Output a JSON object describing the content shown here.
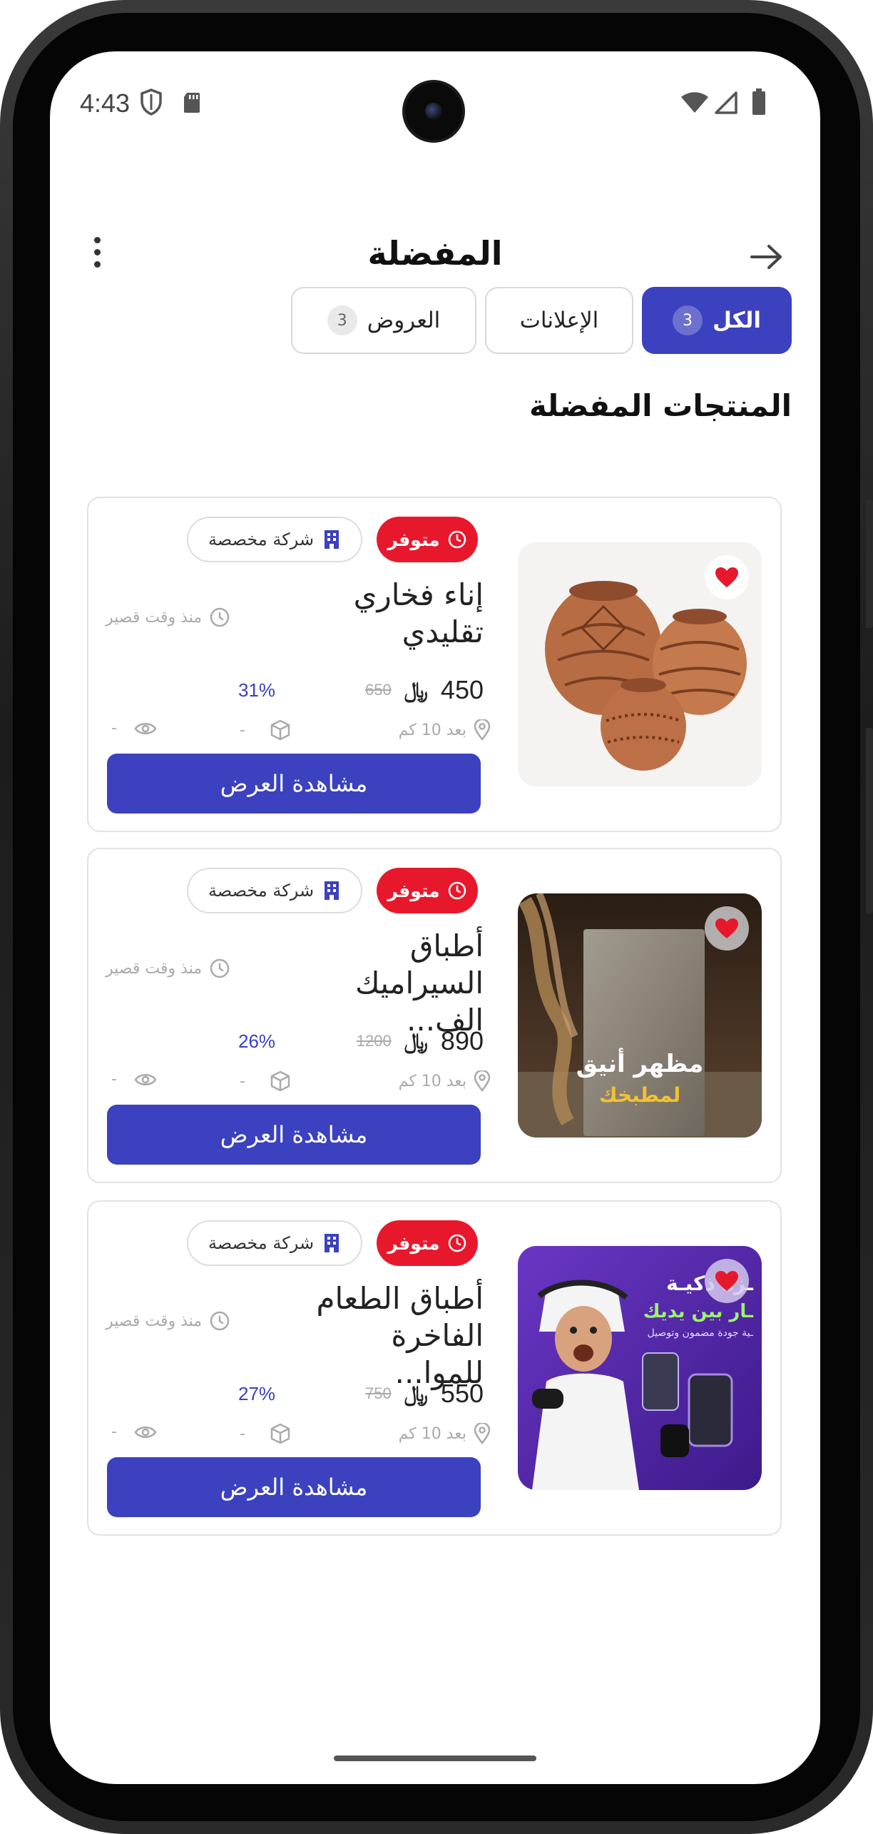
{
  "status_bar": {
    "time": "4:43",
    "icons": [
      "shield-icon",
      "sd-card-icon",
      "wifi-icon",
      "signal-icon",
      "battery-icon"
    ]
  },
  "header": {
    "title": "المفضلة",
    "back_icon": "arrow-right-icon",
    "menu_icon": "more-vertical-icon"
  },
  "tabs": [
    {
      "label": "الكل",
      "count": "3",
      "active": true
    },
    {
      "label": "الإعلانات",
      "count": "",
      "active": false
    },
    {
      "label": "العروض",
      "count": "3",
      "active": false
    }
  ],
  "section_title": "المنتجات المفضلة",
  "colors": {
    "primary": "#3c41bf",
    "available_badge": "#e8182c",
    "favorite_heart": "#e8182c"
  },
  "products": [
    {
      "title": "إناء فخاري تقليدي",
      "badge_available": "متوفر",
      "badge_company": "شركة مخصصة",
      "time_ago": "منذ وقت قصير",
      "price": "450",
      "old_price": "650",
      "discount": "31%",
      "location": "بعد 10 كم",
      "box_value": "-",
      "views_value": "-",
      "button_label": "مشاهدة العرض",
      "image": "clay-pots"
    },
    {
      "title": "أطباق السيراميك الف...",
      "badge_available": "متوفر",
      "badge_company": "شركة مخصصة",
      "time_ago": "منذ وقت قصير",
      "price": "890",
      "old_price": "1200",
      "discount": "26%",
      "location": "بعد 10 كم",
      "box_value": "-",
      "views_value": "-",
      "button_label": "مشاهدة العرض",
      "image": "kitchen-ceramic",
      "image_text_line1": "مظهر أنيق",
      "image_text_line2": "لمطبخك"
    },
    {
      "title": "أطباق الطعام الفاخرة للموا...",
      "badge_available": "متوفر",
      "badge_company": "شركة مخصصة",
      "time_ago": "منذ وقت قصير",
      "price": "550",
      "old_price": "750",
      "discount": "27%",
      "location": "بعد 10 كم",
      "box_value": "-",
      "views_value": "-",
      "button_label": "مشاهدة العرض",
      "image": "electronics-promo",
      "image_text_line1": "ـزة ذكيـة",
      "image_text_line2": "ـار بين يديك",
      "image_text_line3": "ـية جودة مضمون وتوصيل"
    }
  ]
}
